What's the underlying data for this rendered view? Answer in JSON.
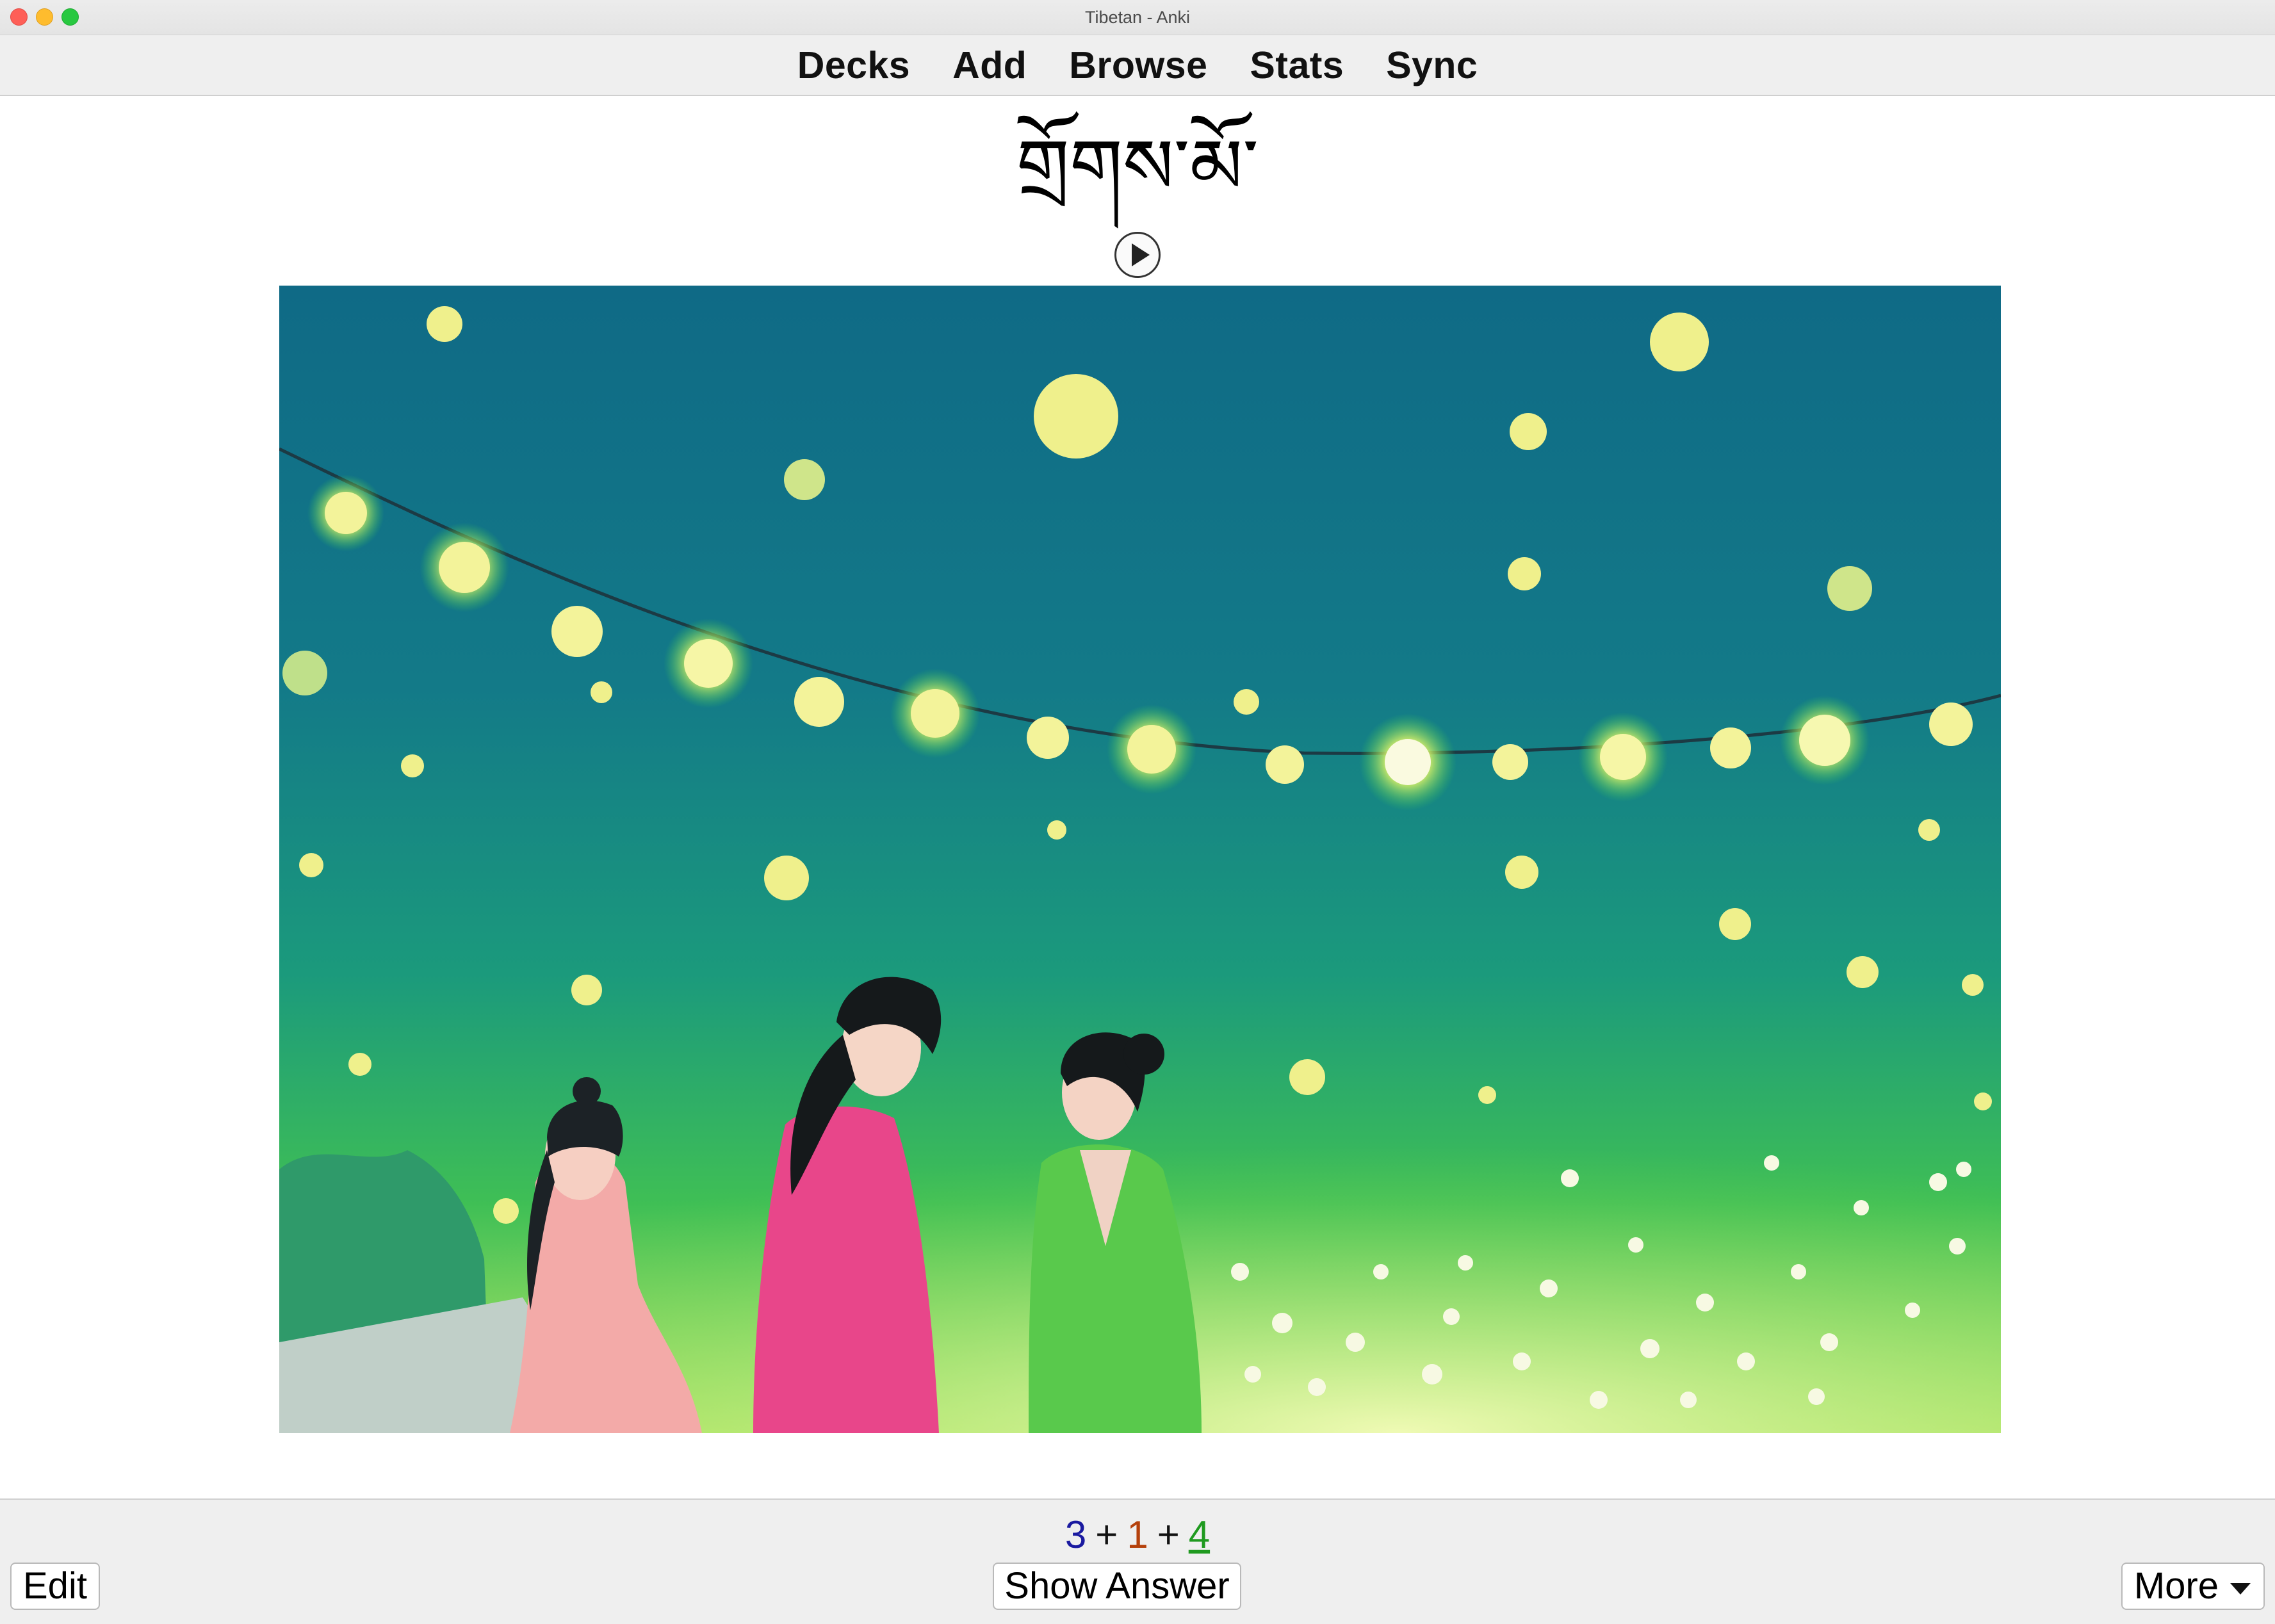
{
  "window": {
    "title": "Tibetan - Anki"
  },
  "nav": {
    "items": [
      "Decks",
      "Add",
      "Browse",
      "Stats",
      "Sync"
    ]
  },
  "card": {
    "question": "གྲོགས་མོ་",
    "play_icon": "play-icon",
    "image_subject": "three-girls-under-lanterns-illustration"
  },
  "counts": {
    "new": "3",
    "learning": "1",
    "review": "4",
    "separator": "+"
  },
  "buttons": {
    "edit": "Edit",
    "show_answer": "Show Answer",
    "more": "More"
  },
  "colors": {
    "new": "#1a1aa0",
    "learning": "#b5410b",
    "review": "#1f9a1f"
  }
}
